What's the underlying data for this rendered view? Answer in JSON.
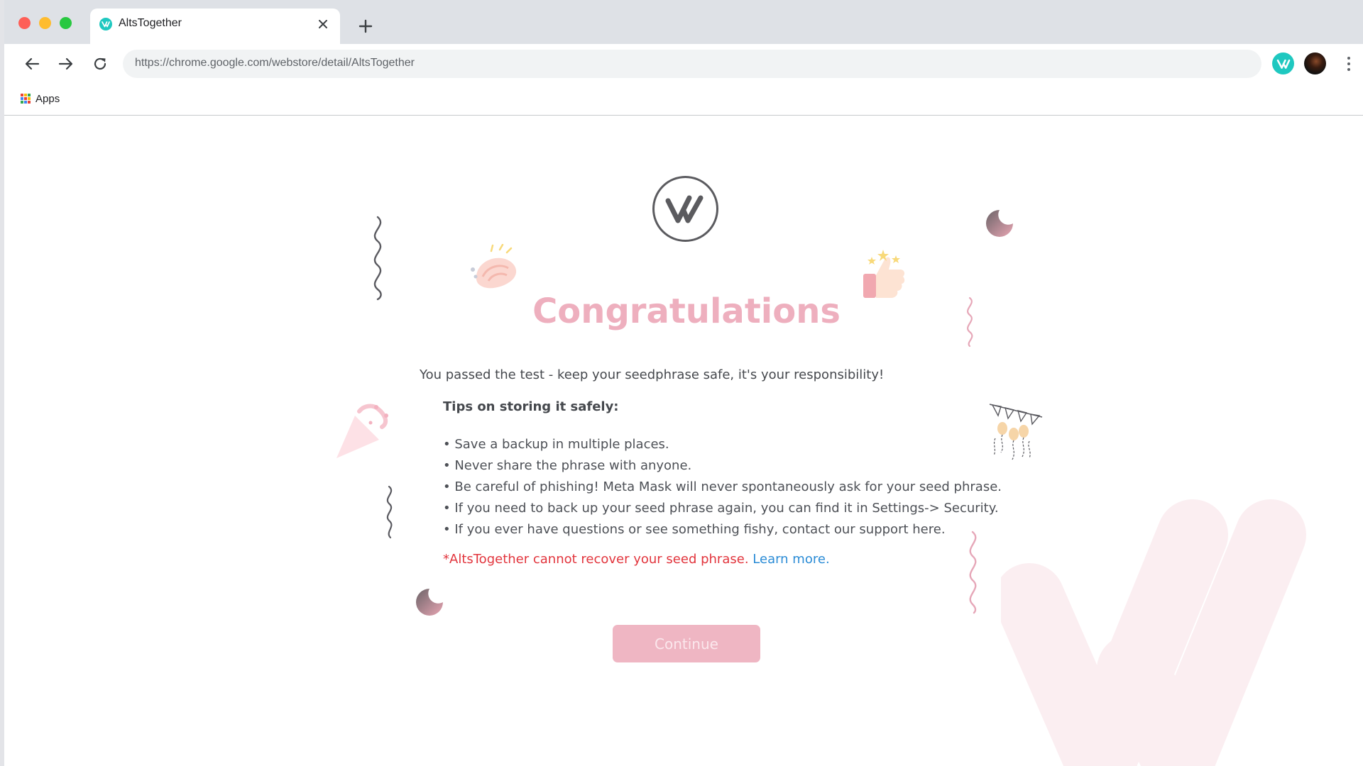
{
  "browser": {
    "tab_title": "AltsTogether",
    "url": "https://chrome.google.com/webstore/detail/AltsTogether",
    "bookmark_apps_label": "Apps"
  },
  "page": {
    "title": "Congratulations",
    "lead": "You passed the test - keep your seedphrase safe, it's your responsibility!",
    "tips_heading": "Tips on storing it safely:",
    "tips": [
      "• Save a backup in multiple places.",
      "• Never share the phrase with anyone.",
      "• Be careful of phishing! Meta Mask will never spontaneously ask for your seed phrase.",
      "• If you need to back up your seed phrase again, you can find it in Settings-> Security.",
      "• If you ever have questions or see something fishy, contact our support here."
    ],
    "warning_text": "*AltsTogether cannot recover your seed phrase.",
    "learn_more": "Learn more.",
    "continue_label": "Continue"
  },
  "colors": {
    "accent_teal": "#1fc8c0",
    "title_pink": "#eeafbe",
    "button_pink": "#efb6c3",
    "warning_red": "#e2353d",
    "link_blue": "#2b8cd6"
  },
  "icons": [
    "close-icon",
    "plus-icon",
    "back-arrow-icon",
    "forward-arrow-icon",
    "reload-icon",
    "apps-grid-icon",
    "more-vert-icon",
    "altstogether-logo"
  ]
}
